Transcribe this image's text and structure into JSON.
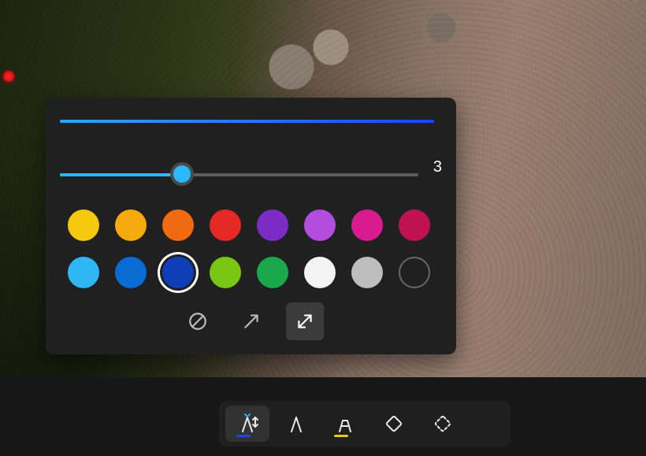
{
  "slider": {
    "value": "3",
    "percent": 34
  },
  "colors": {
    "row1": [
      "#f6c80e",
      "#f4a90c",
      "#f06a12",
      "#e52823",
      "#7a2cc4",
      "#b24de0",
      "#d81a8e",
      "#c01251"
    ],
    "row2": [
      "#2fb6f5",
      "#0b6bd4",
      "#0e3fb8",
      "#7ac614",
      "#19a84a",
      "#f4f4f4",
      "#bdbdbd",
      ""
    ],
    "selected_index": 10,
    "hollow_index": 15
  },
  "tips": {
    "items": [
      "none",
      "single",
      "double"
    ],
    "selected": 2
  },
  "toolbar": {
    "items": [
      {
        "name": "pen-tool",
        "accent": "#1548ff",
        "dropdown": true
      },
      {
        "name": "pen-plain-tool",
        "accent": "",
        "dropdown": false
      },
      {
        "name": "highlighter-tool",
        "accent": "#f6c80e",
        "dropdown": false
      },
      {
        "name": "eraser-tool",
        "accent": "",
        "dropdown": false
      },
      {
        "name": "crop-tool",
        "accent": "",
        "dropdown": false
      }
    ],
    "selected": 0
  }
}
